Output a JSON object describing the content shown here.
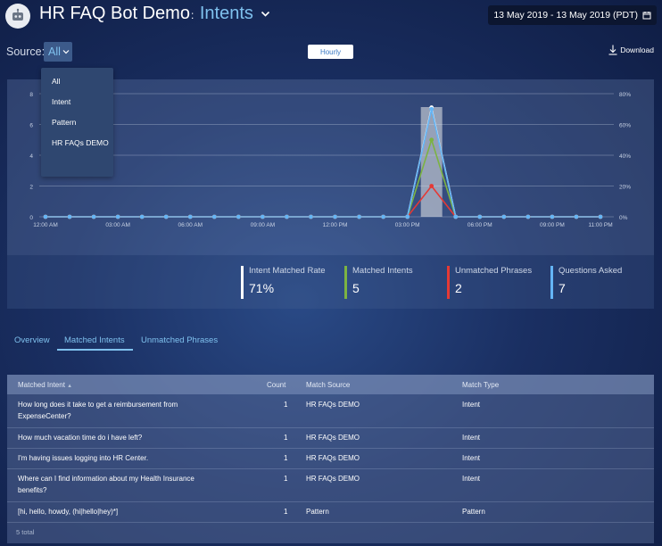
{
  "header": {
    "title_main": "HR FAQ Bot Demo",
    "title_sep": ":",
    "title_section": "Intents",
    "date_range": "13 May 2019 - 13 May 2019 (PDT)"
  },
  "toolbar": {
    "source_label": "Source:",
    "source_value": "All",
    "hourly_label": "Hourly",
    "download_label": "Download"
  },
  "source_dropdown": {
    "options": [
      "All",
      "Intent",
      "Pattern",
      "HR FAQs DEMO"
    ],
    "selected_index": 0
  },
  "chart_data": {
    "type": "line",
    "x": [
      "12:00 AM",
      "1:00 AM",
      "2:00 AM",
      "03:00 AM",
      "4:00 AM",
      "5:00 AM",
      "06:00 AM",
      "7:00 AM",
      "8:00 AM",
      "09:00 AM",
      "10:00 AM",
      "11:00 AM",
      "12:00 PM",
      "1:00 PM",
      "2:00 PM",
      "03:00 PM",
      "4:00 PM",
      "5:00 PM",
      "06:00 PM",
      "7:00 PM",
      "8:00 PM",
      "09:00 PM",
      "10:00 PM",
      "11:00 PM"
    ],
    "x_tick_labels": [
      "12:00 AM",
      "03:00 AM",
      "06:00 AM",
      "09:00 AM",
      "12:00 PM",
      "03:00 PM",
      "06:00 PM",
      "09:00 PM",
      "11:00 PM"
    ],
    "x_tick_indices": [
      0,
      3,
      6,
      9,
      12,
      15,
      18,
      21,
      23
    ],
    "y_left_ticks": [
      "0",
      "2",
      "4",
      "6",
      "8"
    ],
    "y_left_lim": [
      0,
      8
    ],
    "y_right_ticks": [
      "0%",
      "20%",
      "40%",
      "60%",
      "80%"
    ],
    "y_right_lim": [
      0,
      80
    ],
    "highlight_index": 16,
    "grid": true,
    "series": [
      {
        "color": "#ffffff",
        "axis": "right",
        "values": [
          0,
          0,
          0,
          0,
          0,
          0,
          0,
          0,
          0,
          0,
          0,
          0,
          0,
          0,
          0,
          0,
          71,
          0,
          0,
          0,
          0,
          0,
          0,
          0
        ]
      },
      {
        "color": "#7cb342",
        "axis": "left",
        "values": [
          0,
          0,
          0,
          0,
          0,
          0,
          0,
          0,
          0,
          0,
          0,
          0,
          0,
          0,
          0,
          0,
          5,
          0,
          0,
          0,
          0,
          0,
          0,
          0
        ]
      },
      {
        "color": "#e53935",
        "axis": "left",
        "values": [
          0,
          0,
          0,
          0,
          0,
          0,
          0,
          0,
          0,
          0,
          0,
          0,
          0,
          0,
          0,
          0,
          2,
          0,
          0,
          0,
          0,
          0,
          0,
          0
        ]
      },
      {
        "color": "#64b5f6",
        "axis": "left",
        "values": [
          0,
          0,
          0,
          0,
          0,
          0,
          0,
          0,
          0,
          0,
          0,
          0,
          0,
          0,
          0,
          0,
          7,
          0,
          0,
          0,
          0,
          0,
          0,
          0
        ]
      }
    ]
  },
  "stats": [
    {
      "label": "Intent Matched Rate",
      "value": "71%",
      "color": "#ffffff"
    },
    {
      "label": "Matched Intents",
      "value": "5",
      "color": "#7cb342"
    },
    {
      "label": "Unmatched Phrases",
      "value": "2",
      "color": "#e53935"
    },
    {
      "label": "Questions Asked",
      "value": "7",
      "color": "#64b5f6"
    }
  ],
  "tabs": [
    "Overview",
    "Matched Intents",
    "Unmatched Phrases"
  ],
  "active_tab": 1,
  "table": {
    "columns": [
      "Matched Intent",
      "Count",
      "Match Source",
      "Match Type"
    ],
    "rows": [
      {
        "intent": [
          "How long does it take to get a reimbursement from",
          "ExpenseCenter?"
        ],
        "count": "1",
        "source": "HR FAQs DEMO",
        "type": "Intent"
      },
      {
        "intent": [
          "How much vacation time do i have left?"
        ],
        "count": "1",
        "source": "HR FAQs DEMO",
        "type": "Intent"
      },
      {
        "intent": [
          "I'm having issues logging into HR Center."
        ],
        "count": "1",
        "source": "HR FAQs DEMO",
        "type": "Intent"
      },
      {
        "intent": [
          "Where can I find information about my Health Insurance",
          "benefits?"
        ],
        "count": "1",
        "source": "HR FAQs DEMO",
        "type": "Intent"
      },
      {
        "intent": [
          "[hi, hello, howdy, (hi|hello|hey)*]"
        ],
        "count": "1",
        "source": "Pattern",
        "type": "Pattern"
      }
    ],
    "total": "5 total"
  },
  "colors": {
    "accent": "#7fc1ee",
    "highlight_bar": "#b8bfcc"
  }
}
